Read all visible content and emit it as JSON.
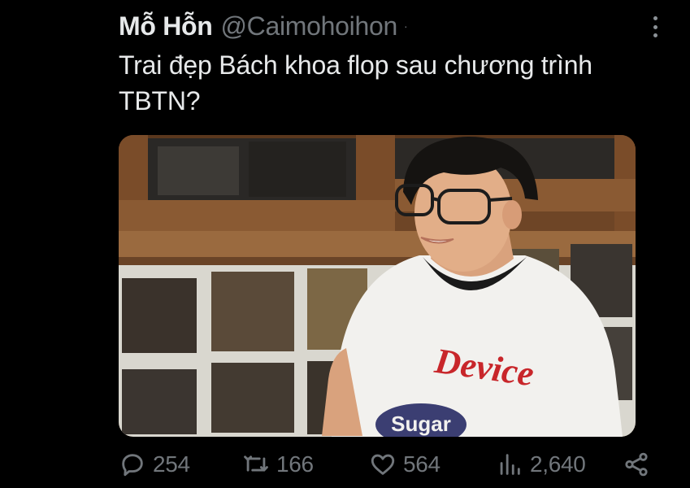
{
  "author": {
    "display_name": "Mỗ Hỗn",
    "handle": "@Caimohoihon",
    "separator": "·"
  },
  "tweet": {
    "text": "Trai đẹp Bách khoa flop sau chương trình TBTN?"
  },
  "media": {
    "shirt_print_top": "Device",
    "shirt_print_bottom": "Sugar"
  },
  "actions": {
    "replies": "254",
    "retweets": "166",
    "likes": "564",
    "views": "2,640"
  },
  "icons": {
    "reply": "speech-bubble-icon",
    "retweet": "retweet-arrows-icon",
    "like": "heart-icon",
    "views": "bar-chart-icon",
    "share": "share-nodes-icon",
    "more": "vertical-ellipsis-icon"
  },
  "colors": {
    "background": "#000000",
    "text_primary": "#e7e9ea",
    "text_secondary": "#71767b"
  }
}
